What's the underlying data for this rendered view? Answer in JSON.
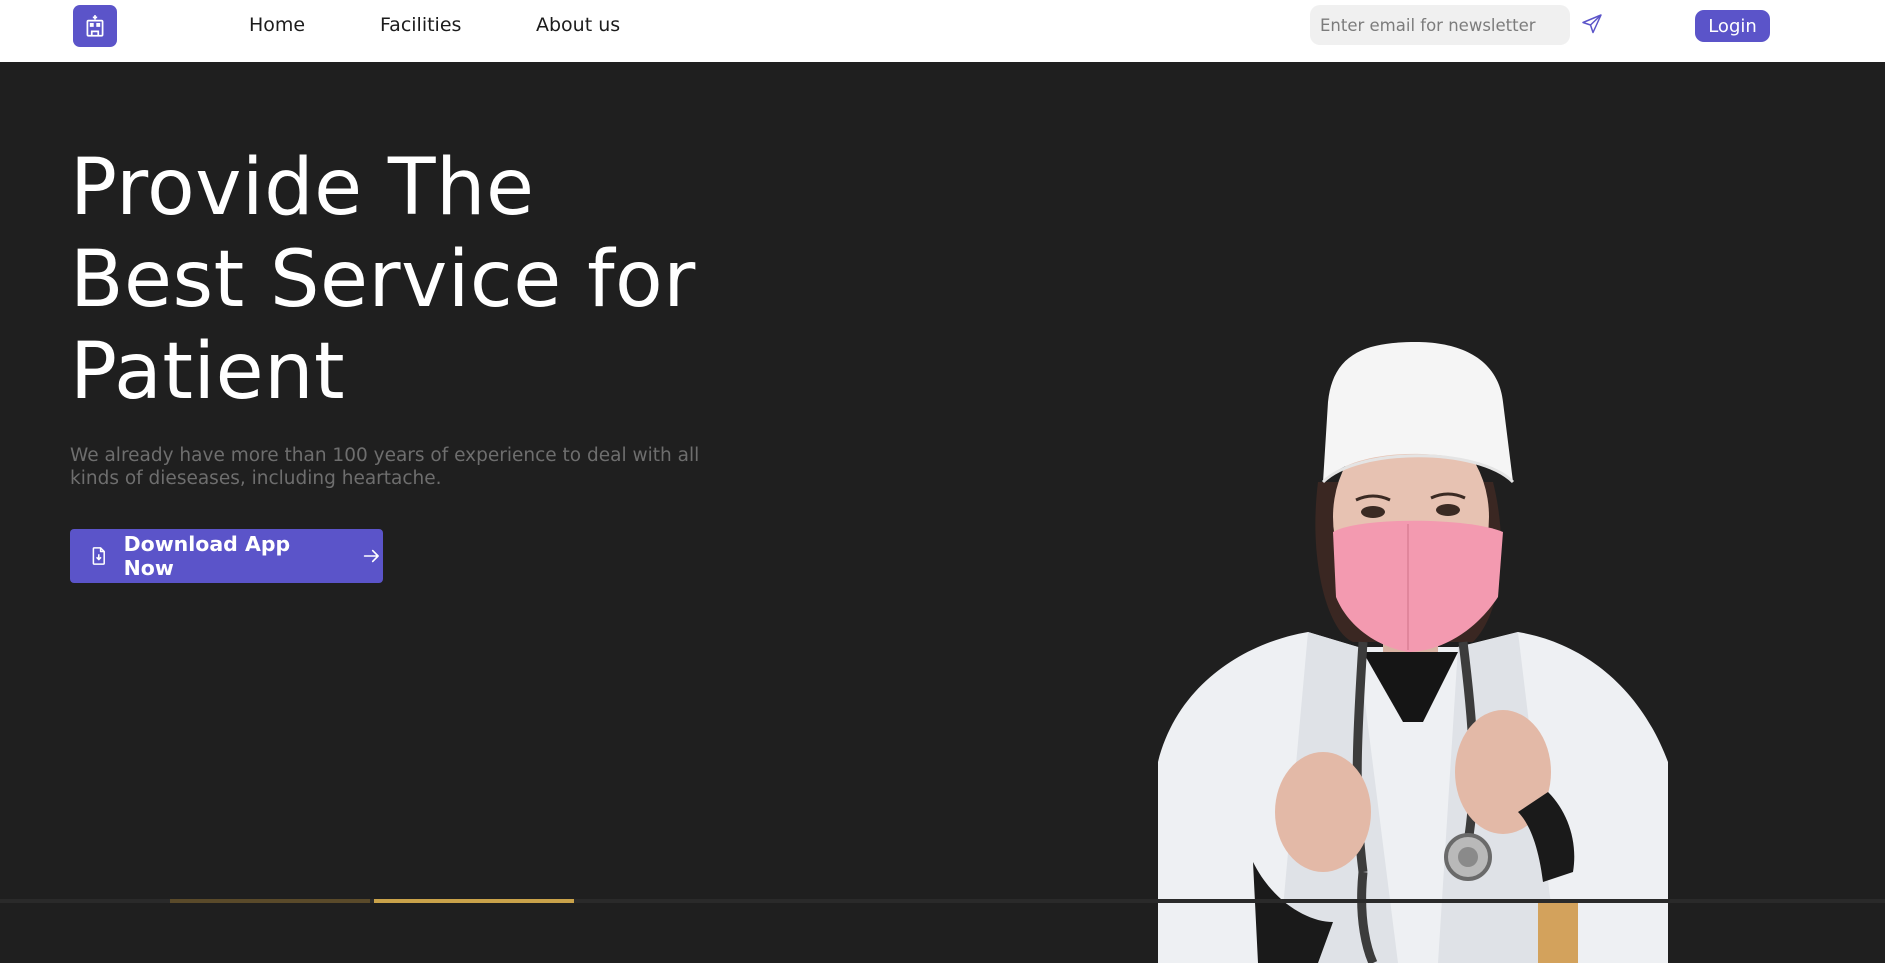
{
  "nav": {
    "links": [
      "Home",
      "Facilities",
      "About us"
    ],
    "newsletter_placeholder": "Enter email for newsletter",
    "login_label": "Login"
  },
  "hero": {
    "title_lines": [
      "Provide The",
      "Best Service for",
      "Patient"
    ],
    "subtitle_lines": [
      "We already have more than 100 years of experience to deal with all",
      "kinds of dieseases, including heartache."
    ],
    "cta_label": "Download App Now"
  },
  "icons": {
    "logo": "hospital-building-icon",
    "send": "paper-plane-icon",
    "cta_left": "file-download-icon",
    "cta_right": "arrow-right-icon",
    "hero_image": "doctor-with-mask-image"
  },
  "colors": {
    "accent": "#5b54c9",
    "hero_bg": "#1f1f1f",
    "nav_bg": "#ffffff"
  }
}
